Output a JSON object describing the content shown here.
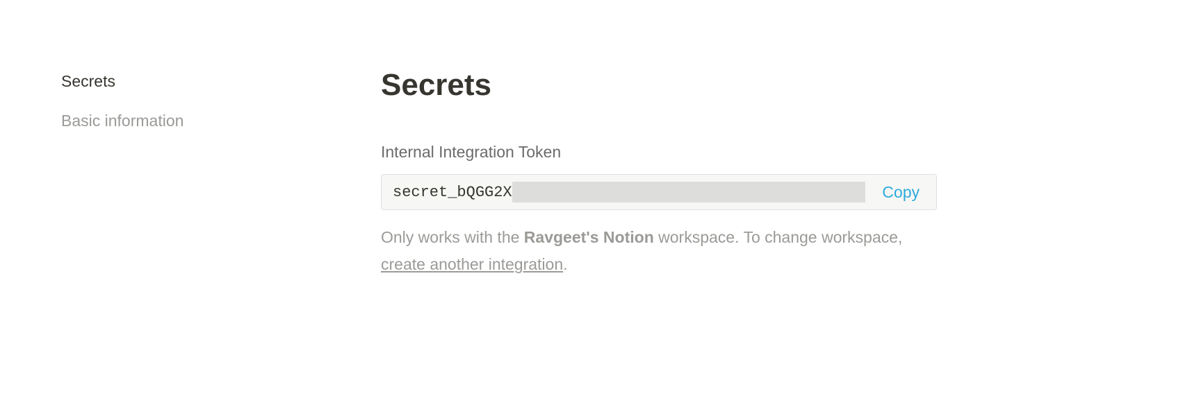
{
  "sidebar": {
    "items": [
      {
        "label": "Secrets",
        "active": true
      },
      {
        "label": "Basic information",
        "active": false
      }
    ]
  },
  "main": {
    "title": "Secrets",
    "token_label": "Internal Integration Token",
    "token_value": "secret_bQGG2X",
    "copy_label": "Copy",
    "help_prefix": "Only works with the ",
    "help_workspace": "Ravgeet's Notion",
    "help_middle": " workspace. To change workspace, ",
    "help_link": "create another integration",
    "help_suffix": "."
  }
}
